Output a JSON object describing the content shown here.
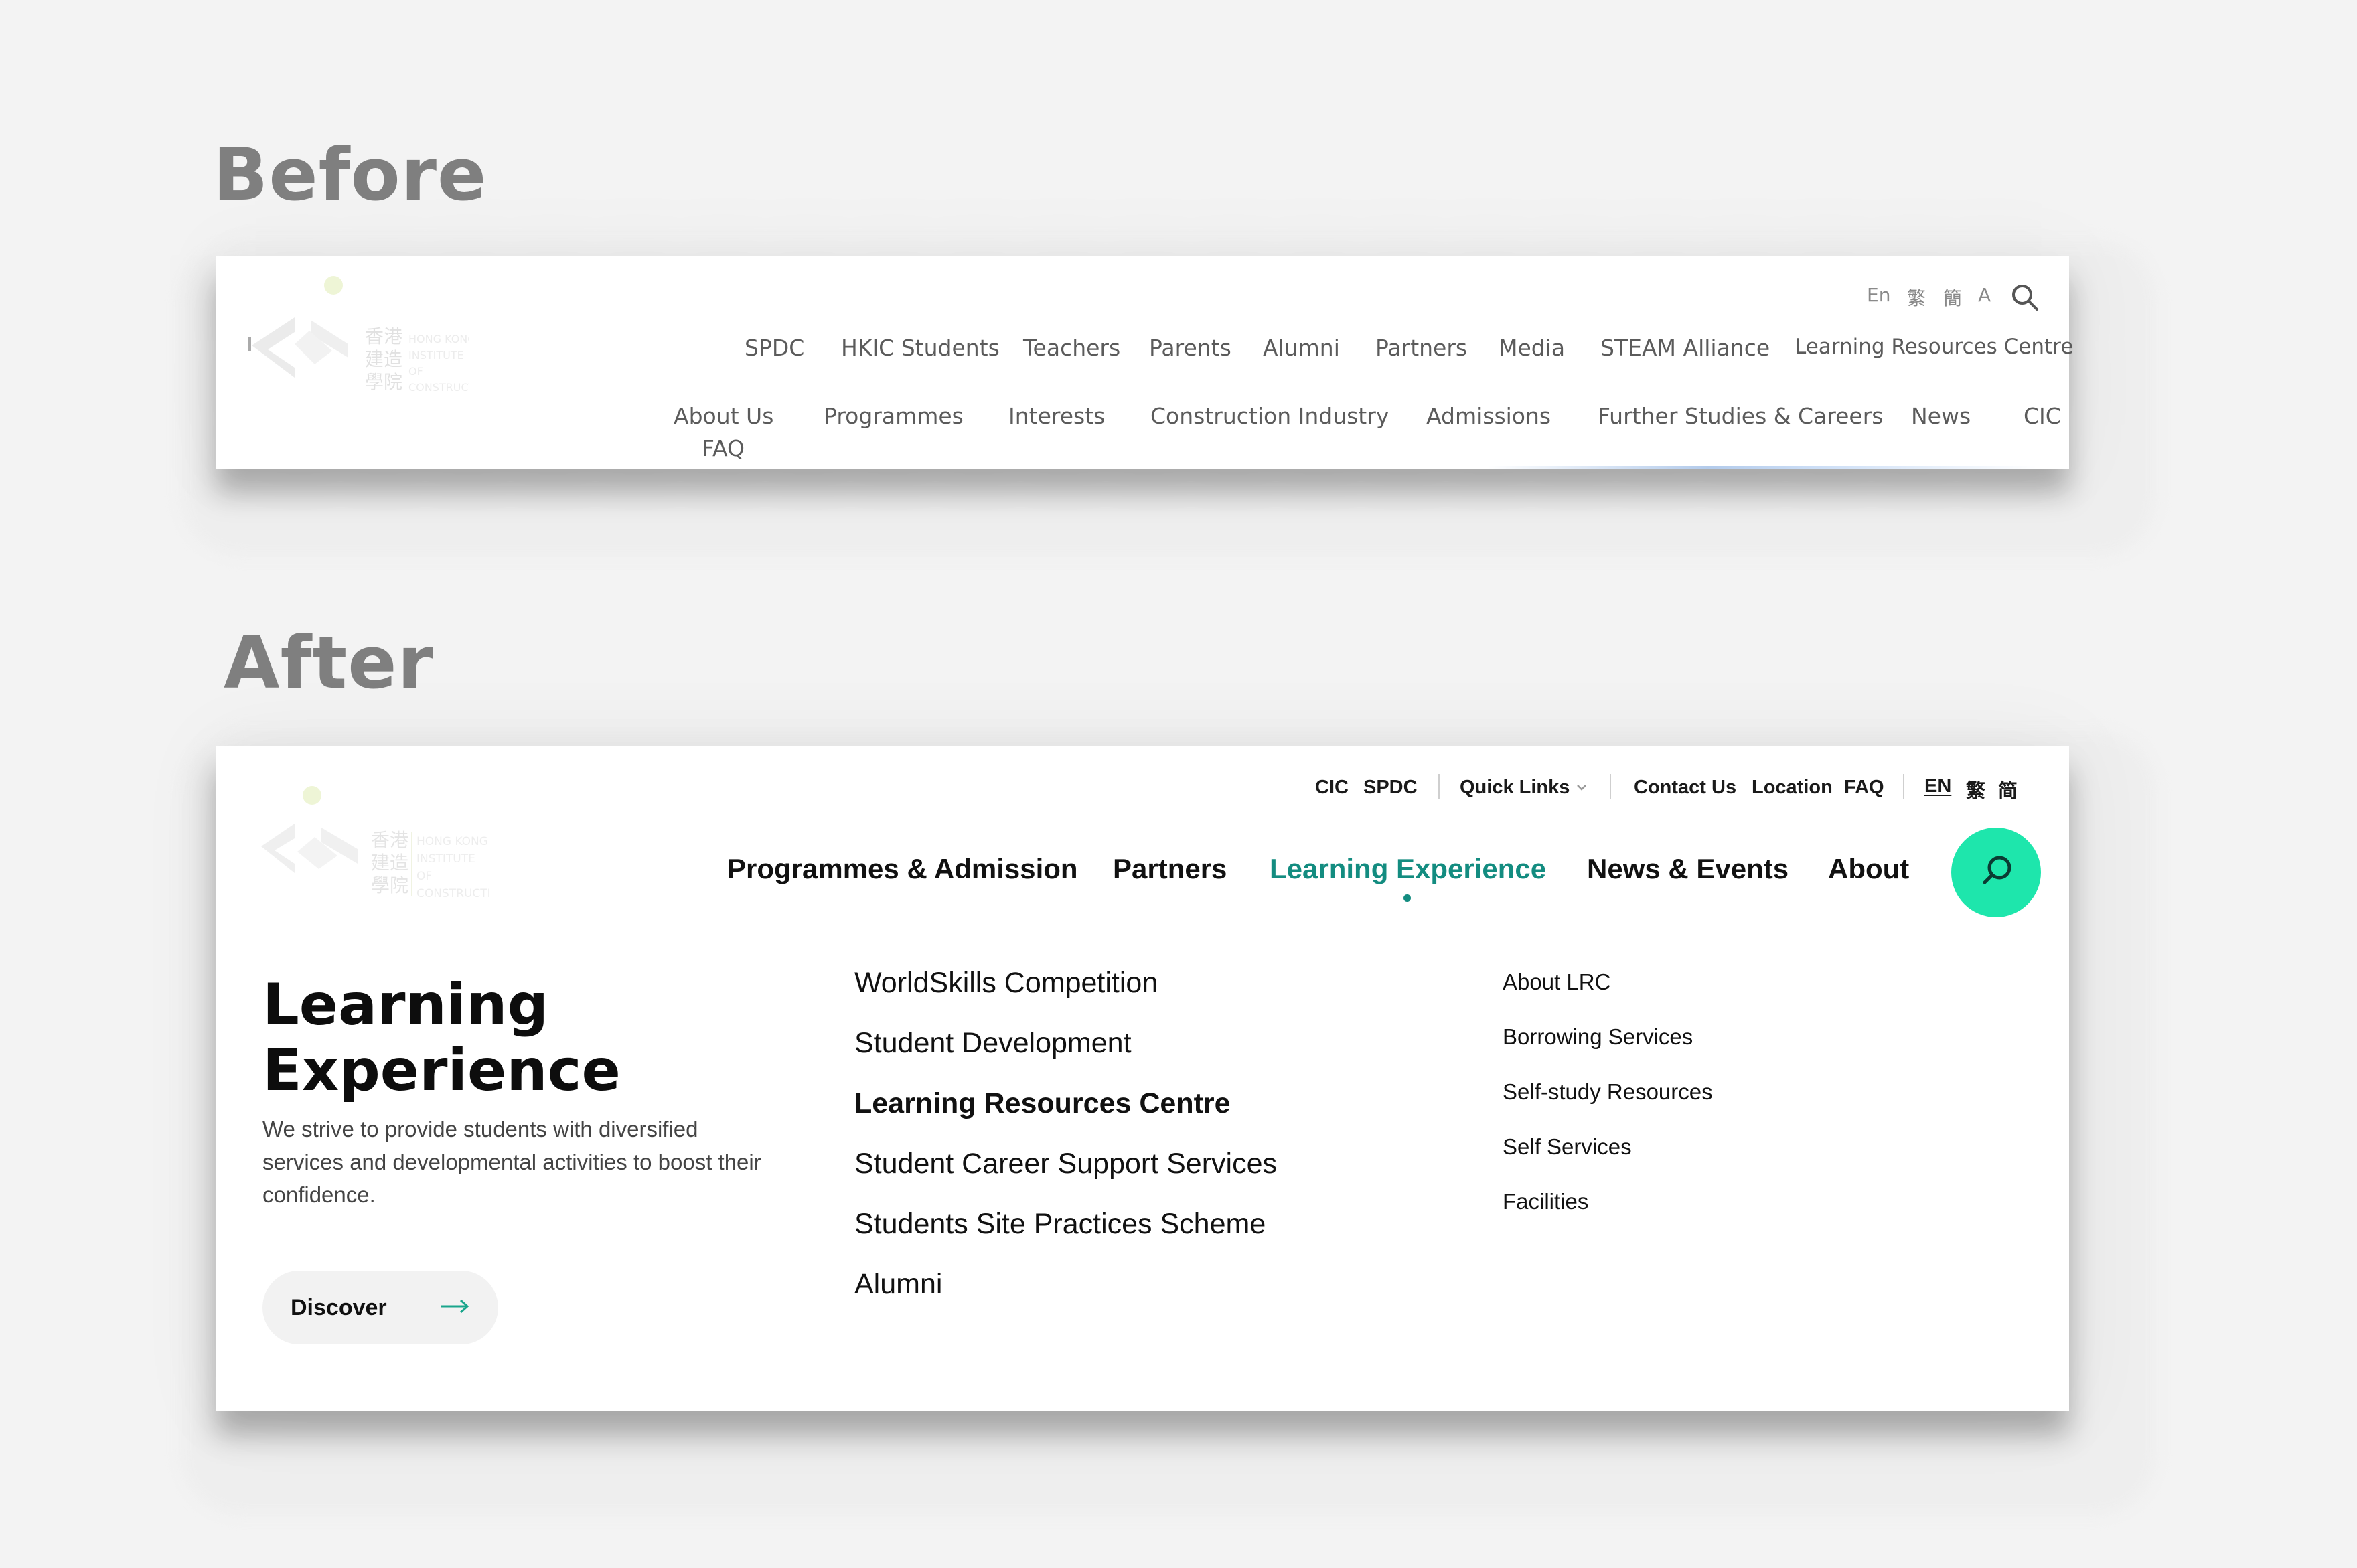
{
  "before": {
    "heading": "Before",
    "utility": {
      "lang_en": "En",
      "lang_tc": "繁",
      "lang_sc": "簡",
      "font_size": "A"
    },
    "secondary_nav": [
      "SPDC",
      "HKIC Students",
      "Teachers",
      "Parents",
      "Alumni",
      "Partners",
      "Media",
      "STEAM Alliance",
      "Learning Resources Centre"
    ],
    "primary_nav": [
      "About Us",
      "Programmes",
      "Interests",
      "Construction Industry",
      "Admissions",
      "Further Studies & Careers",
      "News",
      "CIC",
      "FAQ"
    ]
  },
  "after": {
    "heading": "After",
    "utility": {
      "cic": "CIC",
      "spdc": "SPDC",
      "quick_links": "Quick Links",
      "contact": "Contact Us",
      "location": "Location",
      "faq": "FAQ",
      "lang_en": "EN",
      "lang_tc": "繁",
      "lang_sc": "简"
    },
    "main_nav": [
      "Programmes & Admission",
      "Partners",
      "Learning Experience",
      "News & Events",
      "About"
    ],
    "mega": {
      "title_line1": "Learning",
      "title_line2": "Experience",
      "description": "We strive to provide students with diversified services and developmental activities to boost their confidence.",
      "discover": "Discover",
      "middle_links": [
        "WorldSkills Competition",
        "Student Development",
        "Learning Resources Centre",
        "Student Career Support Services",
        "Students Site Practices Scheme",
        "Alumni"
      ],
      "right_links": [
        "About LRC",
        "Borrowing Services",
        "Self-study Resources",
        "Self Services",
        "Facilities"
      ]
    }
  },
  "colors": {
    "accent": "#138c80",
    "search_bg": "#1ee6ac",
    "page_bg": "#f3f3f3"
  },
  "icons": [
    "logo-mark-icon",
    "search-icon",
    "chevron-down-icon",
    "arrow-right-icon"
  ]
}
